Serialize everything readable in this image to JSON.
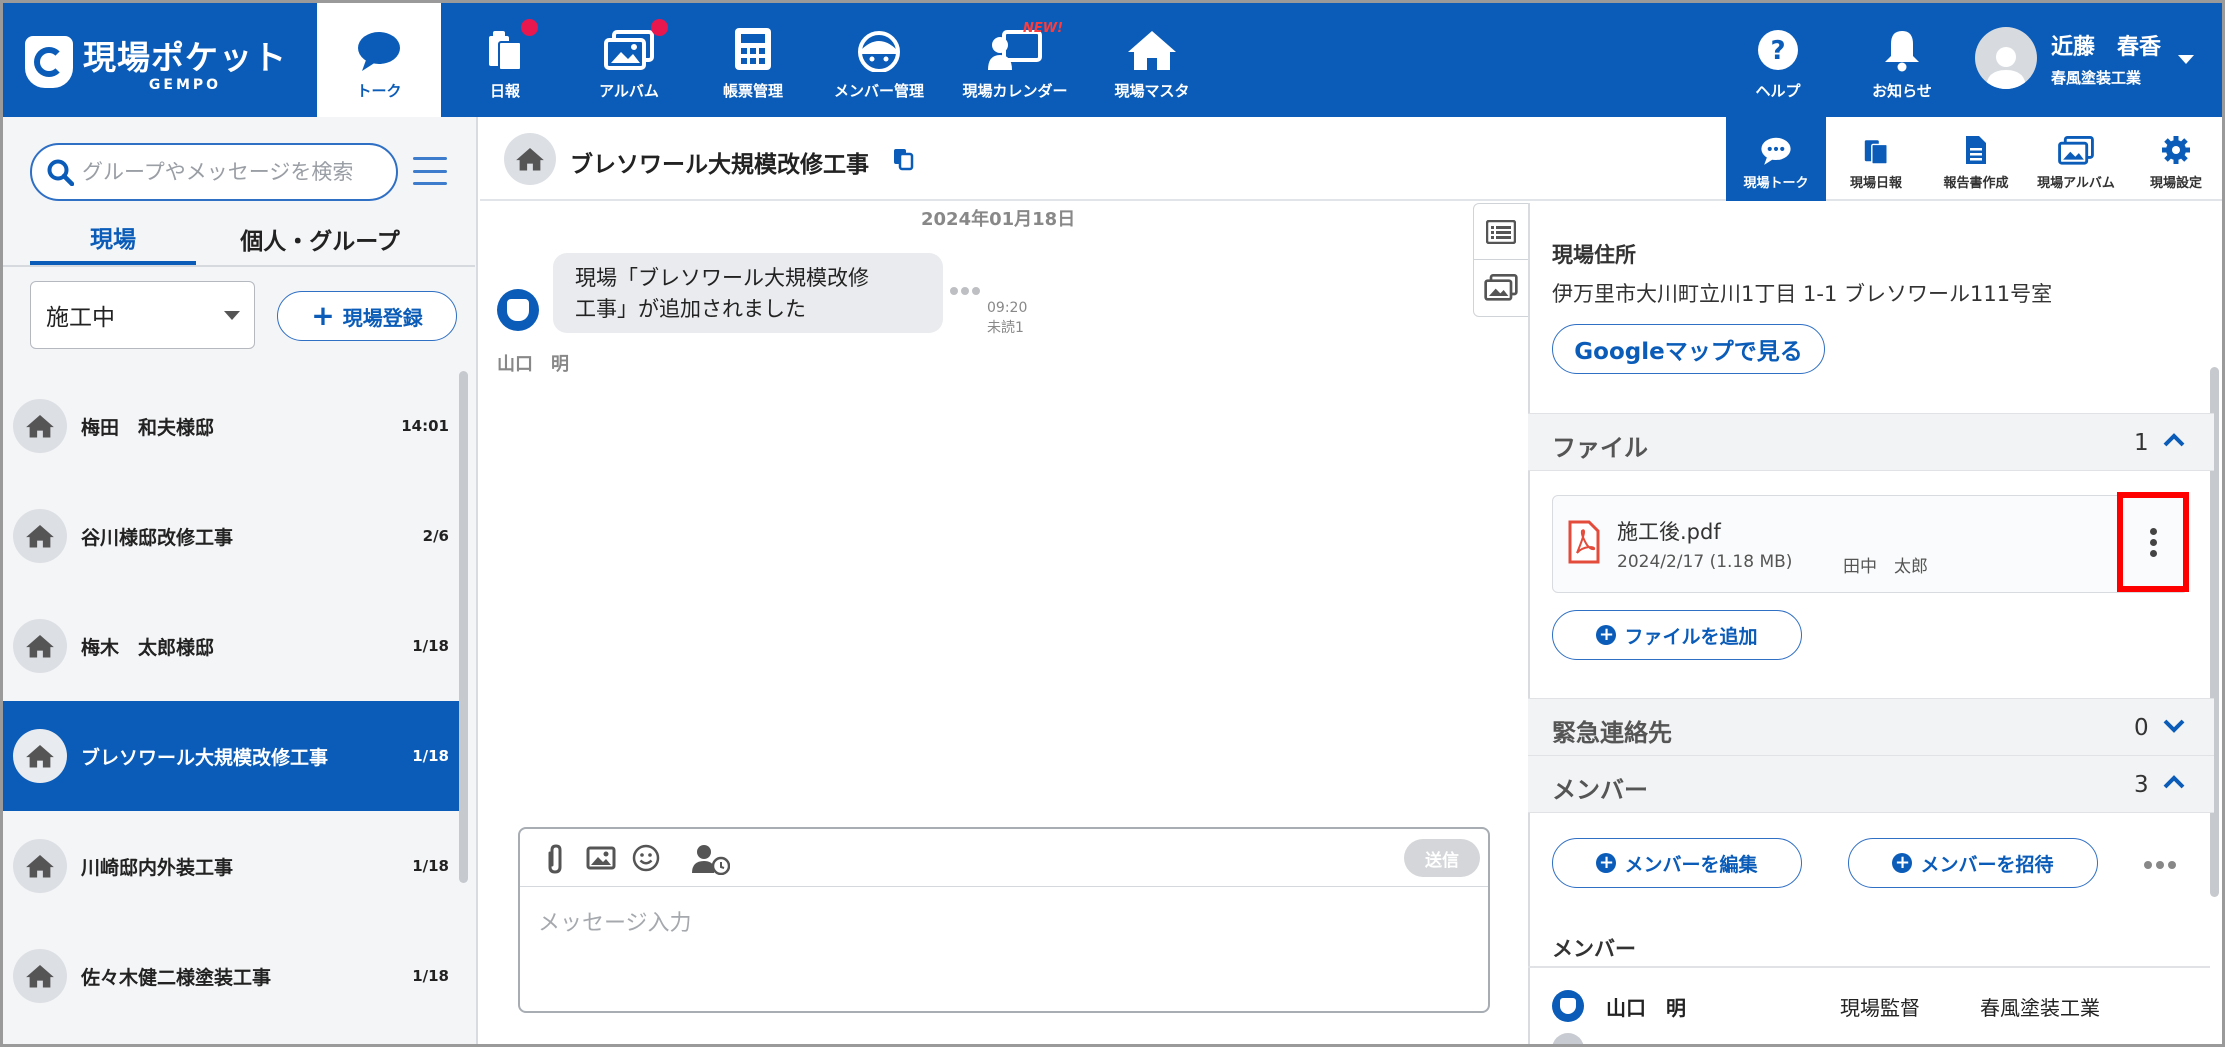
{
  "topnav": {
    "logo_title": "現場ポケット",
    "logo_sub": "GEMPO",
    "items": [
      {
        "label": "トーク",
        "icon": "chat-bubble-icon",
        "active": true
      },
      {
        "label": "日報",
        "icon": "daily-report-icon",
        "badge": true
      },
      {
        "label": "アルバム",
        "icon": "album-icon",
        "badge": true
      },
      {
        "label": "帳票管理",
        "icon": "calculator-icon"
      },
      {
        "label": "メンバー管理",
        "icon": "hardhat-icon"
      },
      {
        "label": "現場カレンダー",
        "icon": "site-calendar-icon",
        "new": "NEW!"
      },
      {
        "label": "現場マスタ",
        "icon": "house-icon"
      }
    ],
    "help_label": "ヘルプ",
    "notify_label": "お知らせ",
    "user_name": "近藤　春香",
    "user_company": "春風塗装工業"
  },
  "sidebar": {
    "search_placeholder": "グループやメッセージを検索",
    "tabs": [
      "現場",
      "個人・グループ"
    ],
    "status_value": "施工中",
    "register_label": "現場登録",
    "sites": [
      {
        "name": "梅田　和夫様邸",
        "time": "14:01"
      },
      {
        "name": "谷川様邸改修工事",
        "time": "2/6"
      },
      {
        "name": "梅木　太郎様邸",
        "time": "1/18"
      },
      {
        "name": "ブレソワール大規模改修工事",
        "time": "1/18",
        "selected": true
      },
      {
        "name": "川崎邸内外装工事",
        "time": "1/18"
      },
      {
        "name": "佐々木健二様塗装工事",
        "time": "1/18"
      }
    ]
  },
  "chat": {
    "title": "ブレソワール大規模改修工事",
    "date": "2024年01月18日",
    "message_line1": "現場「ブレソワール大規模改修",
    "message_line2": "工事」が追加されました",
    "time": "09:20",
    "unread": "未読1",
    "sender": "山口　明",
    "send_label": "送信",
    "input_placeholder": "メッセージ入力"
  },
  "right": {
    "tabs": [
      {
        "label": "現場トーク",
        "icon": "chat-bubble-icon",
        "active": true
      },
      {
        "label": "現場日報",
        "icon": "daily-report-icon"
      },
      {
        "label": "報告書作成",
        "icon": "document-icon"
      },
      {
        "label": "現場アルバム",
        "icon": "album-icon"
      },
      {
        "label": "現場設定",
        "icon": "gear-icon"
      }
    ],
    "address_label": "現場住所",
    "address_value": "伊万里市大川町立川1丁目 1-1 ブレソワール111号室",
    "map_button": "Googleマップで見る",
    "files_title": "ファイル",
    "files_count": "1",
    "file_name": "施工後.pdf",
    "file_meta": "2024/2/17 (1.18 MB)",
    "file_uploader": "田中　太郎",
    "add_file": "ファイルを追加",
    "emergency_title": "緊急連絡先",
    "emergency_count": "0",
    "members_title": "メンバー",
    "members_count": "3",
    "edit_members": "メンバーを編集",
    "invite_members": "メンバーを招待",
    "members_label": "メンバー",
    "member1": {
      "name": "山口　明",
      "role": "現場監督",
      "company": "春風塗装工業"
    }
  },
  "colors": {
    "brand": "#0a5cb8",
    "badge": "#e8174d",
    "highlight": "#ff0000"
  }
}
